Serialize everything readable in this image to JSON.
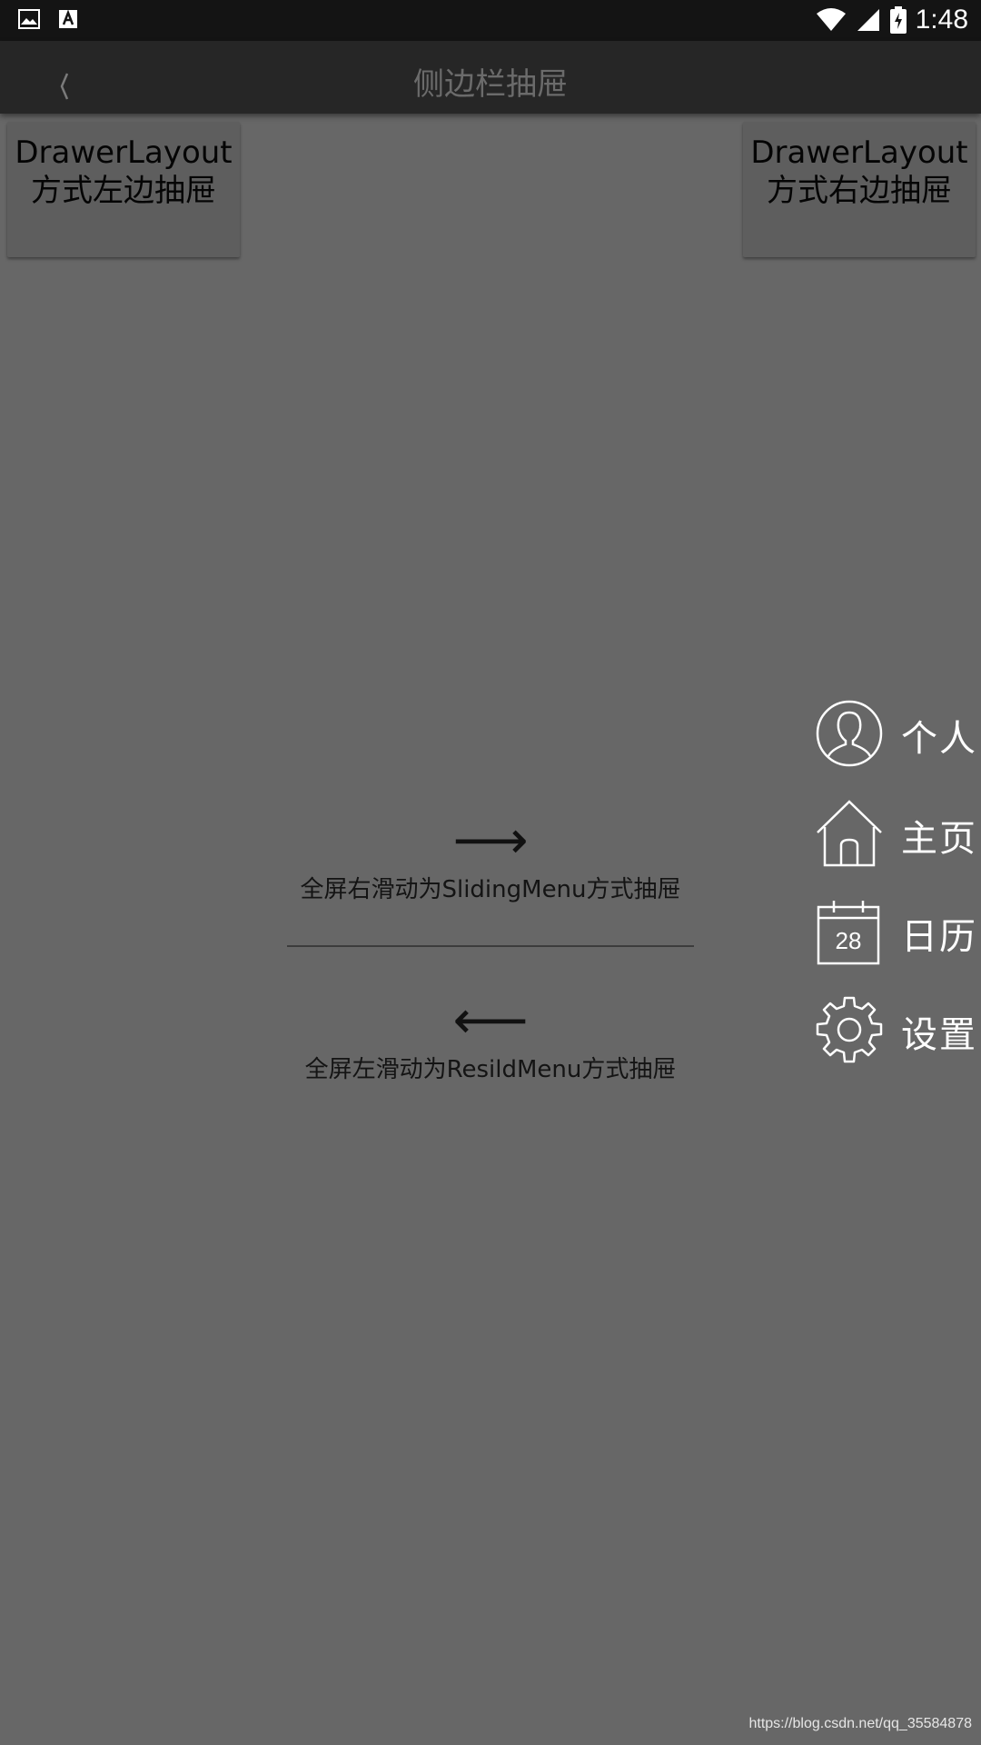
{
  "status_bar": {
    "time": "1:48",
    "left_icons": [
      "image-icon",
      "text-a-icon"
    ],
    "right_icons": [
      "wifi-icon",
      "cell-signal-icon",
      "battery-charging-icon"
    ]
  },
  "toolbar": {
    "title": "侧边栏抽屉",
    "back_icon": "back-chevron-icon"
  },
  "buttons": {
    "left_drawer": "DrawerLayout方式左边抽屉",
    "right_drawer": "DrawerLayout方式右边抽屉"
  },
  "swipe_right": {
    "arrow": "⟶",
    "text": "全屏右滑动为SlidingMenu方式抽屉"
  },
  "swipe_left": {
    "arrow": "⟵",
    "text": "全屏左滑动为ResildMenu方式抽屉"
  },
  "side_menu": {
    "items": [
      {
        "label": "个人",
        "icon": "person-icon"
      },
      {
        "label": "主页",
        "icon": "home-icon"
      },
      {
        "label": "日历",
        "icon": "calendar-icon",
        "icon_text": "28"
      },
      {
        "label": "设置",
        "icon": "gear-icon"
      }
    ]
  },
  "watermark": "https://blog.csdn.net/qq_35584878",
  "colors": {
    "overlay_bg": "#676767",
    "status_bar": "#141414",
    "toolbar": "#262626",
    "menu_text": "#ffffff"
  }
}
